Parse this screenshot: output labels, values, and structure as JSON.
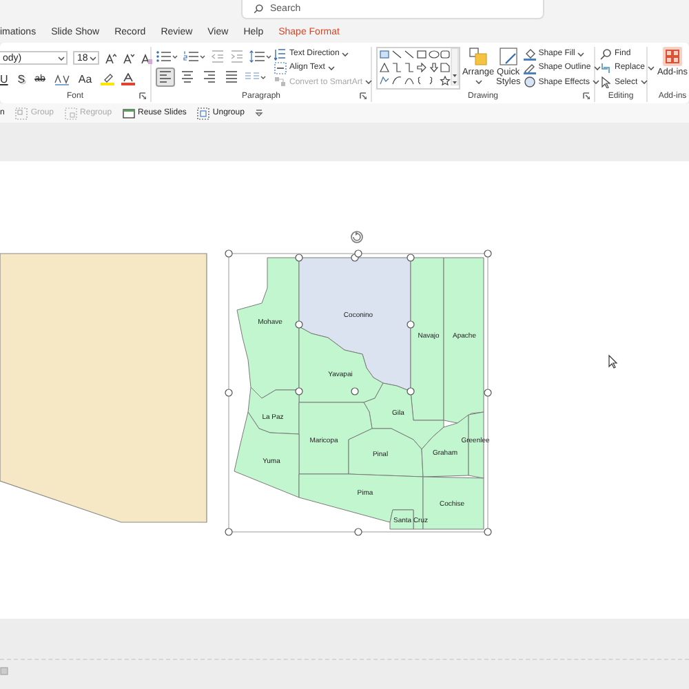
{
  "search": {
    "placeholder": "Search"
  },
  "tabs": [
    {
      "label": "imations",
      "selected": false
    },
    {
      "label": "Slide Show",
      "selected": false
    },
    {
      "label": "Record",
      "selected": false
    },
    {
      "label": "Review",
      "selected": false
    },
    {
      "label": "View",
      "selected": false
    },
    {
      "label": "Help",
      "selected": false
    },
    {
      "label": "Shape Format",
      "selected": true
    }
  ],
  "font_group": {
    "font_name": "ody)",
    "font_size": "18",
    "format_buttons": [
      {
        "label": "U",
        "kind": "underline"
      },
      {
        "label": "S",
        "kind": "shadow"
      },
      {
        "label": "ab",
        "kind": "strike"
      }
    ],
    "case_button": "Aa",
    "label": "Font"
  },
  "paragraph_group": {
    "commands": [
      {
        "label": "Text Direction",
        "disabled": false
      },
      {
        "label": "Align Text",
        "disabled": false
      },
      {
        "label": "Convert to SmartArt",
        "disabled": true
      }
    ],
    "alignment": [
      {
        "kind": "left",
        "selected": true
      },
      {
        "kind": "center",
        "selected": false
      },
      {
        "kind": "right",
        "selected": false
      },
      {
        "kind": "justify",
        "selected": false
      }
    ],
    "label": "Paragraph"
  },
  "drawing_group": {
    "arrange": "Arrange",
    "quick_styles": "Quick Styles",
    "commands": [
      "Shape Fill",
      "Shape Outline",
      "Shape Effects"
    ],
    "label": "Drawing"
  },
  "editing_group": {
    "commands": [
      "Find",
      "Replace",
      "Select"
    ],
    "label": "Editing"
  },
  "addins_group": {
    "button": "Add-ins",
    "label": "Add-ins"
  },
  "quick_toolbar": [
    {
      "label": "n",
      "disabled": false
    },
    {
      "label": "Group",
      "disabled": true
    },
    {
      "label": "Regroup",
      "disabled": true
    },
    {
      "label": "Reuse Slides",
      "disabled": false
    },
    {
      "label": "Ungroup",
      "disabled": false
    }
  ],
  "map": {
    "counties": [
      {
        "name": "Mohave",
        "selected": false
      },
      {
        "name": "Coconino",
        "selected": true
      },
      {
        "name": "Navajo",
        "selected": false
      },
      {
        "name": "Apache",
        "selected": false
      },
      {
        "name": "Yavapai",
        "selected": false
      },
      {
        "name": "La Paz",
        "selected": false
      },
      {
        "name": "Gila",
        "selected": false
      },
      {
        "name": "Maricopa",
        "selected": false
      },
      {
        "name": "Pinal",
        "selected": false
      },
      {
        "name": "Graham",
        "selected": false
      },
      {
        "name": "Greenlee",
        "selected": false
      },
      {
        "name": "Yuma",
        "selected": false
      },
      {
        "name": "Pima",
        "selected": false
      },
      {
        "name": "Cochise",
        "selected": false
      },
      {
        "name": "Santa Cruz",
        "selected": false
      }
    ]
  }
}
